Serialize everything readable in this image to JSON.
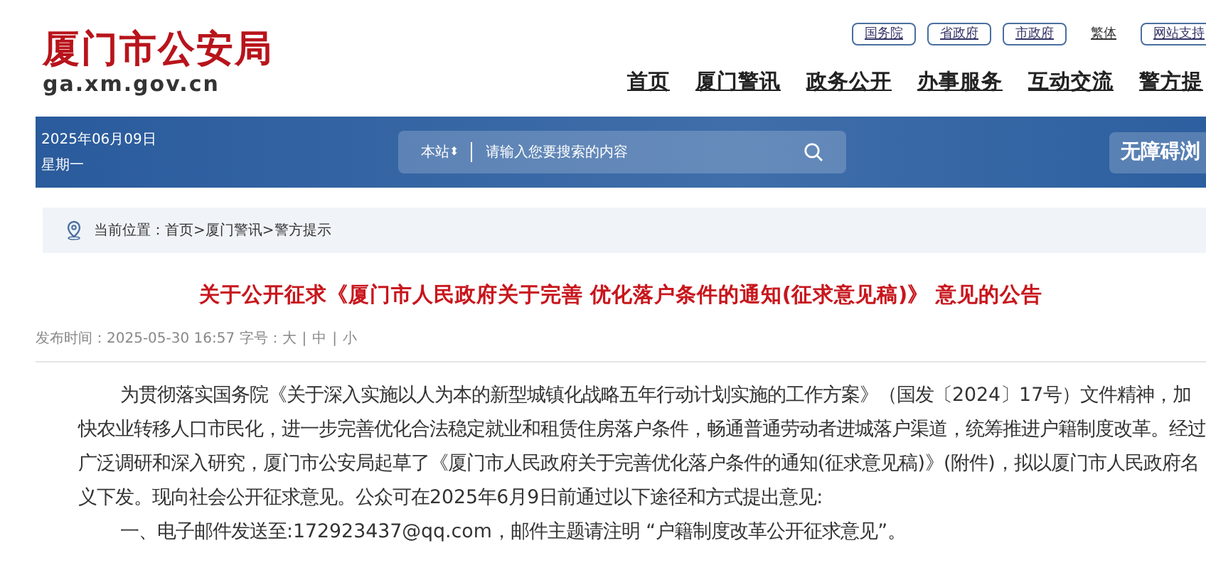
{
  "header": {
    "logo": "厦门市公安局",
    "domain": "ga.xm.gov.cn",
    "top_links": [
      {
        "label": "国务院",
        "kind": "pill"
      },
      {
        "label": "省政府",
        "kind": "pill"
      },
      {
        "label": "市政府",
        "kind": "pill"
      },
      {
        "label": "繁体",
        "kind": "plain"
      },
      {
        "label": "网站支持",
        "kind": "pill"
      }
    ],
    "nav": [
      {
        "label": "首页"
      },
      {
        "label": "厦门警讯"
      },
      {
        "label": "政务公开"
      },
      {
        "label": "办事服务"
      },
      {
        "label": "互动交流"
      },
      {
        "label": "警方提"
      }
    ]
  },
  "banner": {
    "date": "2025年06月09日",
    "weekday": "星期一",
    "search": {
      "scope": "本站",
      "scope_caret": "⬍",
      "placeholder": "请输入您要搜索的内容"
    },
    "accessibility_button": "无障碍浏"
  },
  "breadcrumb": "当前位置：首页>厦门警讯>警方提示",
  "article": {
    "title": "关于公开征求《厦门市人民政府关于完善 优化落户条件的通知(征求意见稿)》 意见的公告",
    "meta": {
      "label": "发布时间：2025-05-30 16:57 字号：",
      "font_sizes": [
        "大",
        "中",
        "小"
      ],
      "separators": [
        "|",
        "|"
      ]
    },
    "paragraphs": [
      "为贯彻落实国务院《关于深入实施以人为本的新型城镇化战略五年行动计划实施的工作方案》（国发〔2024〕17号）文件精神，加快农业转移人口市民化，进一步完善优化合法稳定就业和租赁住房落户条件，畅通普通劳动者进城落户渠道，统筹推进户籍制度改革。经过广泛调研和深入研究，厦门市公安局起草了《厦门市人民政府关于完善优化落户条件的通知(征求意见稿)》(附件)，拟以厦门市人民政府名义下发。现向社会公开征求意见。公众可在2025年6月9日前通过以下途径和方式提出意见:",
      "一、电子邮件发送至:172923437@qq.com，邮件主题请注明 “户籍制度改革公开征求意见”。"
    ]
  }
}
